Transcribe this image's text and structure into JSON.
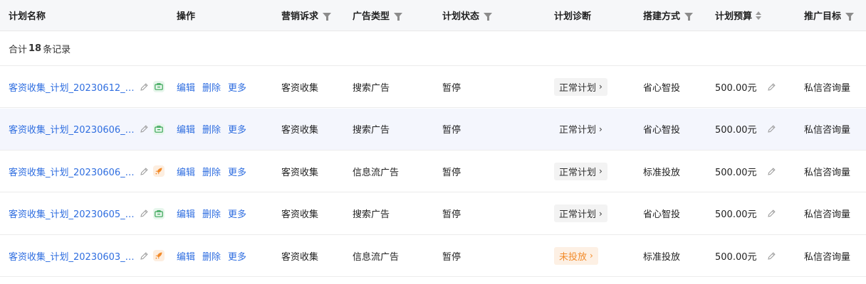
{
  "header": {
    "name": "计划名称",
    "op": "操作",
    "marketing": "营销诉求",
    "ad_type": "广告类型",
    "status": "计划状态",
    "diagnosis": "计划诊断",
    "build": "搭建方式",
    "budget": "计划预算",
    "goal": "推广目标"
  },
  "summary": {
    "prefix": "合计",
    "count": "18",
    "suffix": "条记录"
  },
  "actions": {
    "edit": "编辑",
    "delete": "删除",
    "more": "更多"
  },
  "rows": [
    {
      "name": "客资收集_计划_20230612_1...",
      "tag": "green",
      "marketing": "客资收集",
      "ad_type": "搜索广告",
      "status": "暂停",
      "diagnosis": "正常计划",
      "diag_warn": false,
      "build": "省心智投",
      "budget": "500.00元",
      "goal": "私信咨询量"
    },
    {
      "name": "客资收集_计划_20230606_1...",
      "tag": "green",
      "marketing": "客资收集",
      "ad_type": "搜索广告",
      "status": "暂停",
      "diagnosis": "正常计划",
      "diag_warn": false,
      "build": "省心智投",
      "budget": "500.00元",
      "goal": "私信咨询量"
    },
    {
      "name": "客资收集_计划_20230606_1...",
      "tag": "orange",
      "marketing": "客资收集",
      "ad_type": "信息流广告",
      "status": "暂停",
      "diagnosis": "正常计划",
      "diag_warn": false,
      "build": "标准投放",
      "budget": "500.00元",
      "goal": "私信咨询量"
    },
    {
      "name": "客资收集_计划_20230605_1...",
      "tag": "green",
      "marketing": "客资收集",
      "ad_type": "搜索广告",
      "status": "暂停",
      "diagnosis": "正常计划",
      "diag_warn": false,
      "build": "省心智投",
      "budget": "500.00元",
      "goal": "私信咨询量"
    },
    {
      "name": "客资收集_计划_20230603_1...",
      "tag": "orange",
      "marketing": "客资收集",
      "ad_type": "信息流广告",
      "status": "暂停",
      "diagnosis": "未投放",
      "diag_warn": true,
      "build": "标准投放",
      "budget": "500.00元",
      "goal": "私信咨询量"
    }
  ],
  "icons": {
    "filter": "filter-icon",
    "sort": "sort-icon",
    "edit": "pencil-icon",
    "search_tag": "search-ad-icon",
    "feed_tag": "rocket-icon"
  },
  "colors": {
    "link": "#2f6ee0",
    "warn": "#f28b2b",
    "tag_green": "#3aa657",
    "tag_orange": "#f28b2b"
  }
}
